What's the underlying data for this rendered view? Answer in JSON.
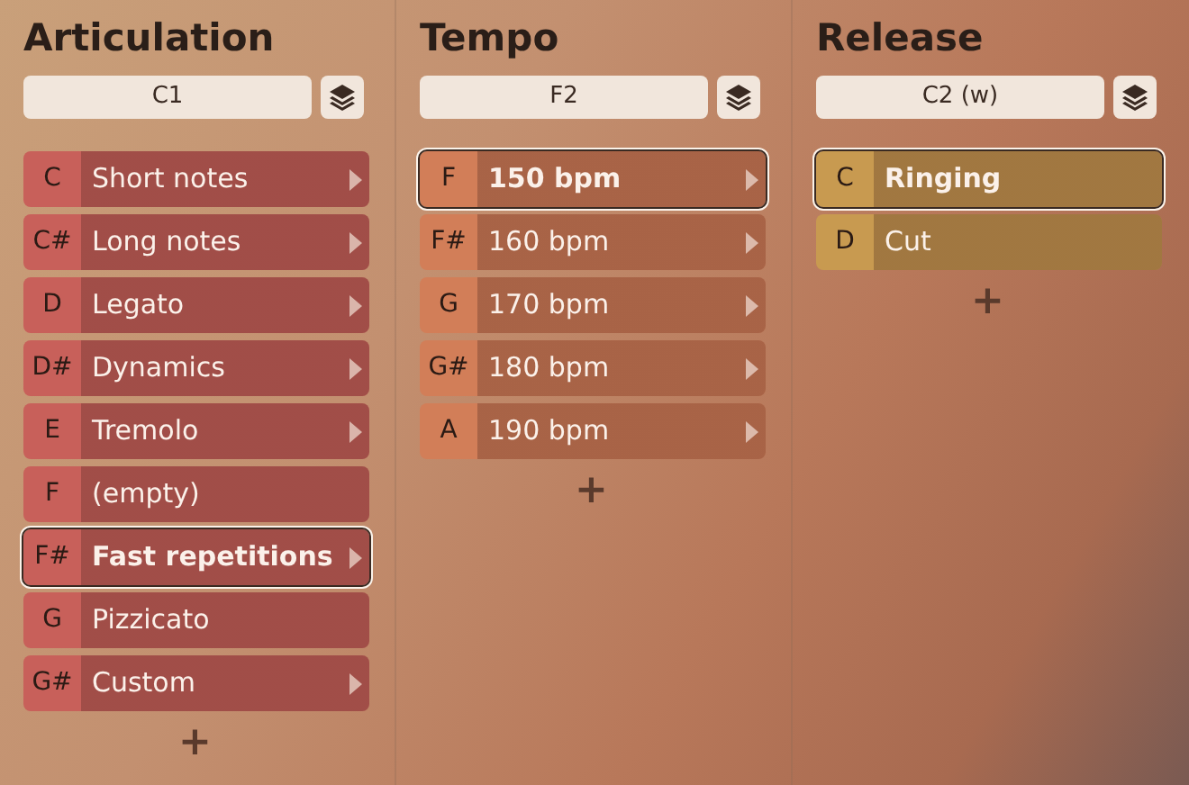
{
  "columns": [
    {
      "title": "Articulation",
      "field": "C1",
      "color": "#c8605a",
      "items": [
        {
          "key": "C",
          "label": "Short notes",
          "submenu": true,
          "selected": false
        },
        {
          "key": "C#",
          "label": "Long notes",
          "submenu": true,
          "selected": false
        },
        {
          "key": "D",
          "label": "Legato",
          "submenu": true,
          "selected": false
        },
        {
          "key": "D#",
          "label": "Dynamics",
          "submenu": true,
          "selected": false
        },
        {
          "key": "E",
          "label": "Tremolo",
          "submenu": true,
          "selected": false
        },
        {
          "key": "F",
          "label": "(empty)",
          "submenu": false,
          "selected": false
        },
        {
          "key": "F#",
          "label": "Fast repetitions",
          "submenu": true,
          "selected": true
        },
        {
          "key": "G",
          "label": "Pizzicato",
          "submenu": false,
          "selected": false
        },
        {
          "key": "G#",
          "label": "Custom",
          "submenu": true,
          "selected": false
        }
      ],
      "add": "+"
    },
    {
      "title": "Tempo",
      "field": "F2",
      "color": "#d27e58",
      "items": [
        {
          "key": "F",
          "label": "150 bpm",
          "submenu": true,
          "selected": true
        },
        {
          "key": "F#",
          "label": "160 bpm",
          "submenu": true,
          "selected": false
        },
        {
          "key": "G",
          "label": "170 bpm",
          "submenu": true,
          "selected": false
        },
        {
          "key": "G#",
          "label": "180 bpm",
          "submenu": true,
          "selected": false
        },
        {
          "key": "A",
          "label": "190 bpm",
          "submenu": true,
          "selected": false
        }
      ],
      "add": "+"
    },
    {
      "title": "Release",
      "field": "C2 (w)",
      "color": "#c89a50",
      "items": [
        {
          "key": "C",
          "label": "Ringing",
          "submenu": false,
          "selected": true
        },
        {
          "key": "D",
          "label": "Cut",
          "submenu": false,
          "selected": false
        }
      ],
      "add": "+"
    }
  ]
}
